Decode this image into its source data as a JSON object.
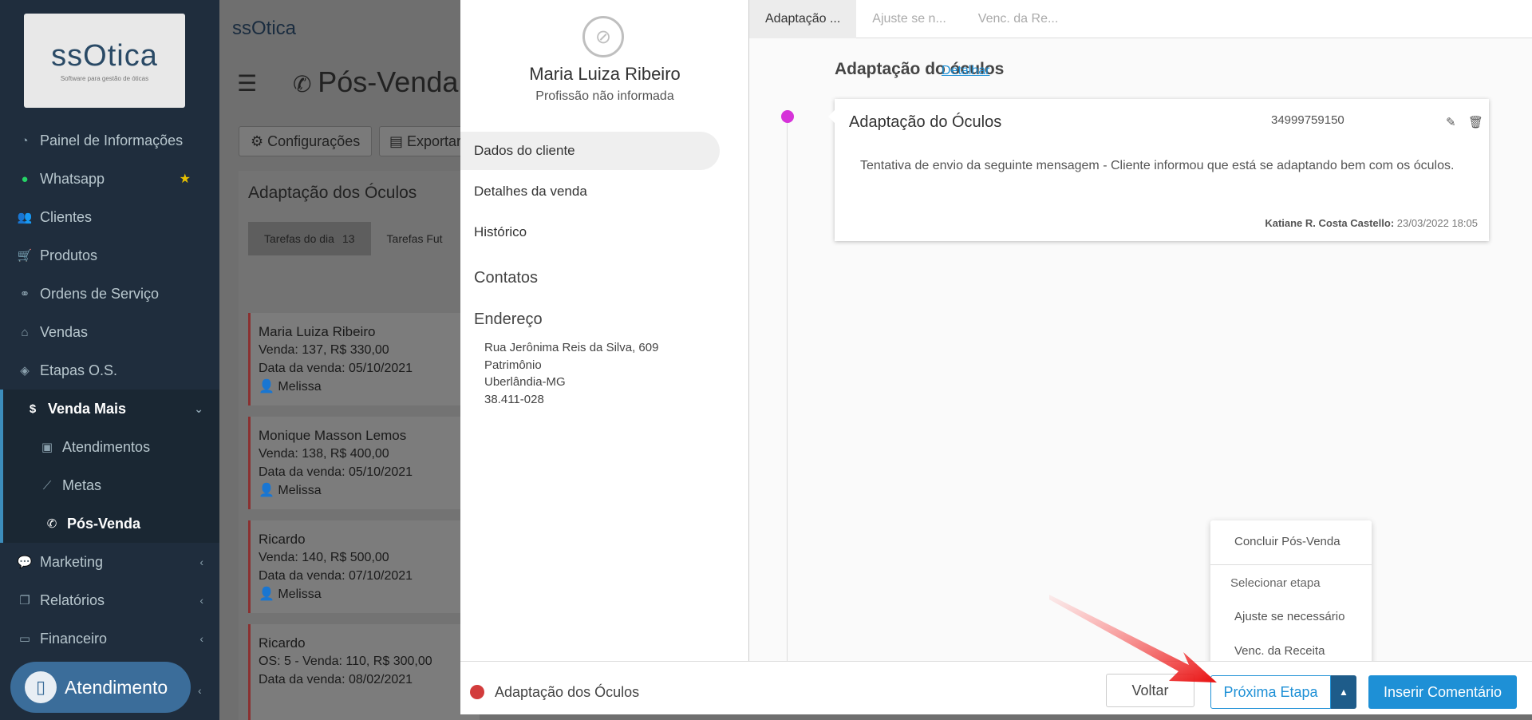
{
  "sidebar": {
    "logo_text": "ssOtica",
    "logo_sub": "Software para gestão de óticas",
    "items": [
      {
        "label": "Painel de Informações",
        "icon": "dashboard-icon"
      },
      {
        "label": "Whatsapp",
        "icon": "whatsapp-icon"
      },
      {
        "label": "Clientes",
        "icon": "users-icon"
      },
      {
        "label": "Produtos",
        "icon": "cart-icon"
      },
      {
        "label": "Ordens de Serviço",
        "icon": "glasses-icon"
      },
      {
        "label": "Vendas",
        "icon": "basket-icon"
      },
      {
        "label": "Etapas O.S.",
        "icon": "tags-icon"
      },
      {
        "label": "Venda Mais",
        "icon": "dollar-icon"
      },
      {
        "label": "Atendimentos",
        "icon": "clipboard-icon"
      },
      {
        "label": "Metas",
        "icon": "chart-icon"
      },
      {
        "label": "Pós-Venda",
        "icon": "phone-icon"
      },
      {
        "label": "Marketing",
        "icon": "comments-icon"
      },
      {
        "label": "Relatórios",
        "icon": "copy-icon"
      },
      {
        "label": "Financeiro",
        "icon": "money-icon"
      }
    ],
    "atendimento_label": "Atendimento"
  },
  "main": {
    "brand": "ssOtica",
    "page_title": "Pós-Venda",
    "btn_config": "Configurações",
    "btn_export": "Exportar",
    "panel_title": "Adaptação dos Óculos",
    "tab_today": "Tarefas do dia",
    "tab_today_count": "13",
    "tab_future": "Tarefas Fut",
    "cards": [
      {
        "name": "Maria Luiza Ribeiro",
        "line1": "Venda: 137, R$ 330,00",
        "line2": "Data da venda: 05/10/2021",
        "line3": "Melissa"
      },
      {
        "name": "Monique Masson Lemos",
        "line1": "Venda: 138, R$ 400,00",
        "line2": "Data da venda: 05/10/2021",
        "line3": "Melissa"
      },
      {
        "name": "Ricardo",
        "line1": "Venda: 140, R$ 500,00",
        "line2": "Data da venda: 07/10/2021",
        "line3": "Melissa"
      },
      {
        "name": "Ricardo",
        "line1": "OS: 5 - Venda: 110, R$ 300,00",
        "line2": "Data da venda: 08/02/2021",
        "line3": ""
      }
    ]
  },
  "modal": {
    "client_name": "Maria Luiza Ribeiro",
    "client_profession": "Profissão não informada",
    "nav": [
      "Dados do cliente",
      "Detalhes da venda",
      "Histórico"
    ],
    "contacts_title": "Contatos",
    "address_title": "Endereço",
    "address_lines": [
      "Rua Jerônima Reis da Silva, 609",
      "Patrimônio",
      "Uberlândia-MG",
      "38.411-028"
    ],
    "stage_tabs": [
      "Adaptação ...",
      "Ajuste se n...",
      "Venc. da Re..."
    ],
    "stage_title": "Adaptação do óculos",
    "detail_link": "Detalhar",
    "comment": {
      "title": "Adaptação do Óculos",
      "phone": "34999759150",
      "text": "Tentativa de envio da seguinte mensagem - Cliente informou que está se adaptando bem com os óculos.",
      "author": "Katiane R. Costa Castello:",
      "datetime": "23/03/2022 18:05"
    },
    "dropdown": {
      "finish": "Concluir Pós-Venda",
      "select_header": "Selecionar etapa",
      "options": [
        "Ajuste se necessário",
        "Venc. da Receita"
      ]
    },
    "footer": {
      "current_stage": "Adaptação dos Óculos",
      "btn_back": "Voltar",
      "btn_next": "Próxima Etapa",
      "btn_insert": "Inserir Comentário"
    }
  },
  "colors": {
    "sidebar_bg": "#1f2d3d",
    "accent_blue": "#1e90d6",
    "timeline_dot": "#d633d9",
    "stage_dot": "#d23c3c"
  }
}
